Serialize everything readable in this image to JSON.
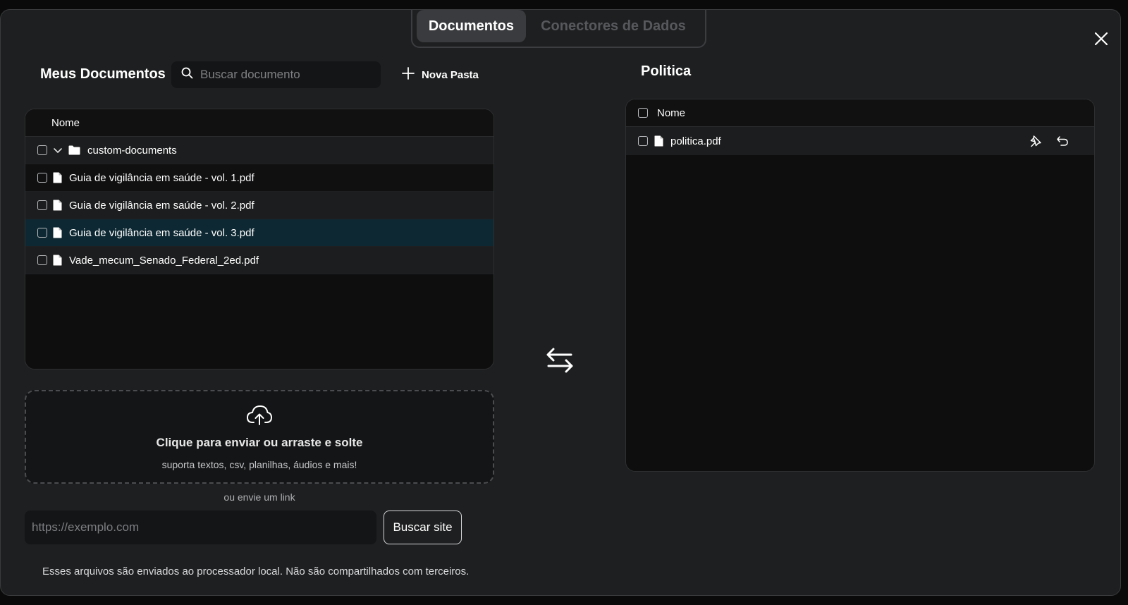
{
  "tabs": [
    {
      "label": "Documentos",
      "active": true
    },
    {
      "label": "Conectores de Dados",
      "active": false
    }
  ],
  "left": {
    "title": "Meus Documentos",
    "search_placeholder": "Buscar documento",
    "new_folder_label": "Nova Pasta",
    "table_header": "Nome",
    "rows": [
      {
        "type": "folder",
        "name": "custom-documents",
        "expanded": true
      },
      {
        "type": "file",
        "name": "Guia de vigilância em saúde - vol. 1.pdf"
      },
      {
        "type": "file",
        "name": "Guia de vigilância em saúde - vol. 2.pdf"
      },
      {
        "type": "file",
        "name": "Guia de vigilância em saúde - vol. 3.pdf",
        "selected": true
      },
      {
        "type": "file",
        "name": "Vade_mecum_Senado_Federal_2ed.pdf"
      }
    ]
  },
  "upload": {
    "title": "Clique para enviar ou arraste e solte",
    "subtitle": "suporta textos, csv, planilhas, áudios e mais!",
    "or_link": "ou envie um link",
    "url_placeholder": "https://exemplo.com",
    "fetch_label": "Buscar site",
    "footer_note": "Esses arquivos são enviados ao processador local. Não são compartilhados com terceiros."
  },
  "right": {
    "title": "Politica",
    "table_header": "Nome",
    "rows": [
      {
        "type": "file",
        "name": "politica.pdf"
      }
    ]
  },
  "colors": {
    "modal_bg": "#1e1f20",
    "table_bg": "#0e0e0f",
    "selected_row": "#0d2832",
    "muted_text": "#7e8083"
  },
  "icons": [
    "close-icon",
    "search-icon",
    "plus-icon",
    "chevron-down-icon",
    "folder-icon",
    "file-icon",
    "swap-arrows-icon",
    "cloud-upload-icon",
    "pin-icon",
    "undo-icon"
  ]
}
